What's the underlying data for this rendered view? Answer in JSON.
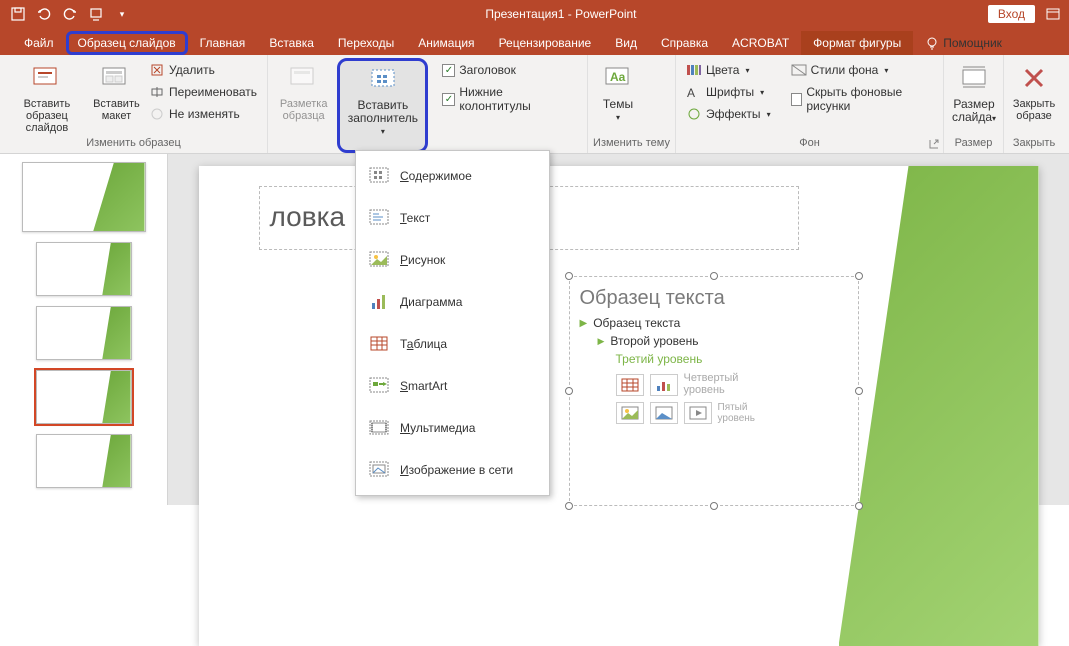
{
  "titlebar": {
    "title": "Презентация1 - PowerPoint",
    "signin": "Вход"
  },
  "tabs": {
    "file": "Файл",
    "slide_master": "Образец слайдов",
    "home": "Главная",
    "insert": "Вставка",
    "transitions": "Переходы",
    "animation": "Анимация",
    "review": "Рецензирование",
    "view": "Вид",
    "help": "Справка",
    "acrobat": "ACROBAT",
    "format_shape": "Формат фигуры",
    "tell_me": "Помощник"
  },
  "ribbon": {
    "edit_master": {
      "insert_slide_master": "Вставить\nобразец слайдов",
      "insert_layout": "Вставить\nмакет",
      "delete": "Удалить",
      "rename": "Переименовать",
      "preserve": "Не изменять",
      "group_label": "Изменить образец"
    },
    "master_layout": {
      "master_layout": "Разметка\nобразца",
      "insert_placeholder": "Вставить\nзаполнитель",
      "title_chk": "Заголовок",
      "footers_chk": "Нижние колонтитулы"
    },
    "edit_theme": {
      "themes": "Темы",
      "group_label": "Изменить тему"
    },
    "background": {
      "colors": "Цвета",
      "fonts": "Шрифты",
      "effects": "Эффекты",
      "background_styles": "Стили фона",
      "hide_bg": "Скрыть фоновые рисунки",
      "group_label": "Фон"
    },
    "size": {
      "slide_size": "Размер\nслайда",
      "group_label": "Размер"
    },
    "close": {
      "close_master": "Закрыть\nобразе",
      "group_label": "Закрыть"
    }
  },
  "dropdown": {
    "content": "Содержимое",
    "text": "Текст",
    "picture": "Рисунок",
    "chart": "Диаграмма",
    "table": "Таблица",
    "smartart": "SmartArt",
    "media": "Мультимедиа",
    "online_image": "Изображение в сети"
  },
  "slide": {
    "title_placeholder": "ловка",
    "body": {
      "header": "Образец текста",
      "l1": "Образец текста",
      "l2": "Второй уровень",
      "l3": "Третий уровень",
      "l4": "Четвертый уровень",
      "l5": "Пятый уровень"
    }
  }
}
